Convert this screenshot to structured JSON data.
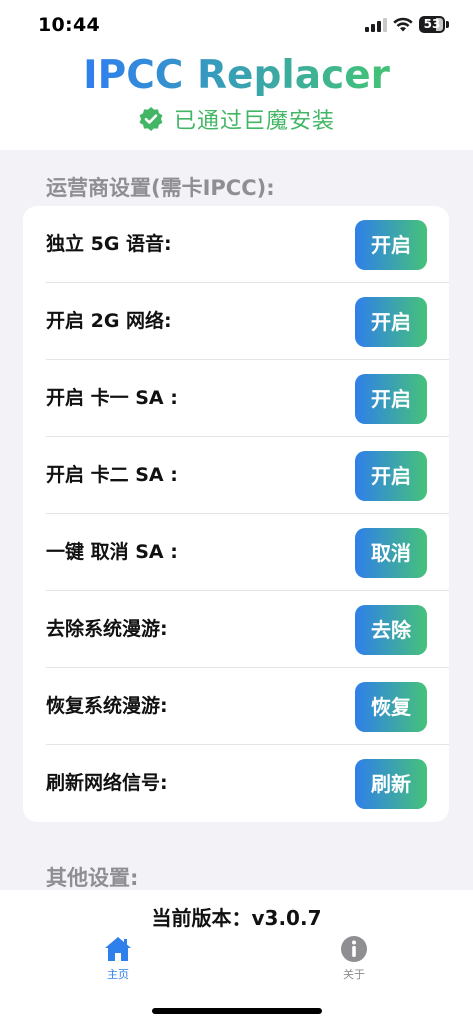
{
  "status_bar": {
    "time": "10:44",
    "battery": "53"
  },
  "header": {
    "app_title": "IPCC Replacer",
    "verified_text": "已通过巨魔安装"
  },
  "carrier_section": {
    "title": "运营商设置(需卡IPCC):",
    "rows": [
      {
        "label": "独立 5G 语音:",
        "button": "开启"
      },
      {
        "label": "开启 2G 网络:",
        "button": "开启"
      },
      {
        "label": "开启 卡一 SA :",
        "button": "开启"
      },
      {
        "label": "开启 卡二 SA :",
        "button": "开启"
      },
      {
        "label": "一键 取消 SA :",
        "button": "取消"
      },
      {
        "label": "去除系统漫游:",
        "button": "去除"
      },
      {
        "label": "恢复系统漫游:",
        "button": "恢复"
      },
      {
        "label": "刷新网络信号:",
        "button": "刷新"
      }
    ]
  },
  "other_section": {
    "title": "其他设置:"
  },
  "footer": {
    "version": "当前版本：v3.0.7"
  },
  "tab_bar": {
    "tabs": [
      {
        "label": "主页",
        "icon": "house-icon",
        "selected": true
      },
      {
        "label": "关于",
        "icon": "info-icon",
        "selected": false
      }
    ]
  },
  "colors": {
    "gradient_start": "#2f7fe9",
    "gradient_end": "#46c27a",
    "verified_green": "#43b665",
    "tab_selected": "#2f80ed",
    "tab_unselected": "#8e8e93"
  }
}
